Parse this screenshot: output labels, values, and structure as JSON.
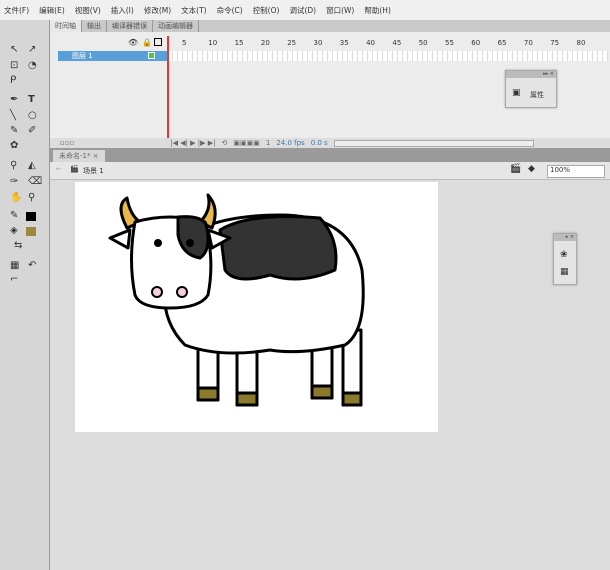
{
  "menu": [
    "文件(F)",
    "编辑(E)",
    "视图(V)",
    "插入(I)",
    "修改(M)",
    "文本(T)",
    "命令(C)",
    "控制(O)",
    "调试(D)",
    "窗口(W)",
    "帮助(H)"
  ],
  "timeline": {
    "tabs": [
      "时间轴",
      "输出",
      "编译器错误",
      "动画编辑器"
    ],
    "layer": "图层 1",
    "ruler": [
      "5",
      "10",
      "15",
      "20",
      "25",
      "30",
      "35",
      "40",
      "45",
      "50",
      "55",
      "60",
      "65",
      "70",
      "75",
      "80"
    ],
    "frame": "1",
    "fps": "24.0 fps",
    "time": "0.0 s"
  },
  "document": {
    "tab": "未命名-1*",
    "close": "×",
    "scene": "场景 1",
    "zoom": "100%"
  },
  "properties_panel": {
    "label": "属性"
  },
  "colors": {
    "hoof": "#8b7a2c",
    "horn": "#e8b84a",
    "fill_swatch": "#9c8a3a"
  }
}
